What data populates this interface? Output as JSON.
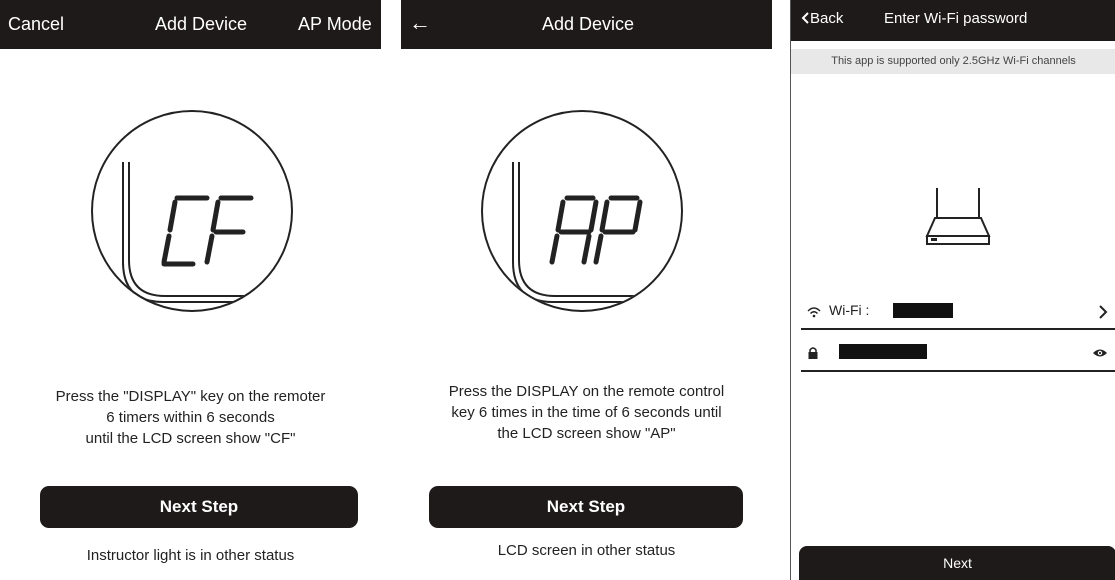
{
  "screen1": {
    "header": {
      "left": "Cancel",
      "title": "Add Device",
      "right": "AP Mode"
    },
    "lcd_code": "CF",
    "instructions": [
      "Press the \"DISPLAY\" key on the remoter",
      "6 timers within 6 seconds",
      "until the LCD screen show \"CF\""
    ],
    "next_label": "Next Step",
    "alt_link": "Instructor light is in other status"
  },
  "screen2": {
    "header": {
      "back_icon": "arrow-left-icon",
      "title": "Add Device"
    },
    "lcd_code": "AP",
    "instructions": [
      "Press the DISPLAY on the remote control",
      "key 6 times in the time of 6 seconds until",
      "the LCD screen show \"AP\""
    ],
    "next_label": "Next Step",
    "alt_link": "LCD screen in other status"
  },
  "screen3": {
    "header": {
      "back_label": "Back",
      "title": "Enter Wi-Fi password"
    },
    "notice": "This app is supported only 2.5GHz Wi-Fi channels",
    "wifi_label": "Wi-Fi :",
    "wifi_value_redacted": true,
    "password_redacted": true,
    "next_label": "Next",
    "icons": [
      "router-icon",
      "wifi-icon",
      "chevron-right-icon",
      "lock-icon",
      "eye-icon"
    ]
  },
  "colors": {
    "bar": "#1e1a1a",
    "text": "#1e1e1e",
    "notice_bg": "#e8e8e8"
  }
}
